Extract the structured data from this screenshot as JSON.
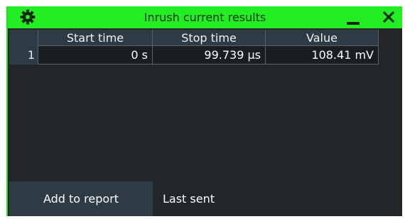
{
  "window": {
    "title": "Inrush current results",
    "accent_color": "#22ee22"
  },
  "icons": {
    "settings": "gear-icon",
    "minimize": "minimize-icon",
    "close": "close-icon"
  },
  "table": {
    "columns": [
      "Start time",
      "Stop time",
      "Value"
    ],
    "rows": [
      {
        "index": "1",
        "start": "0 s",
        "stop": "99.739 µs",
        "value": "108.41 mV"
      }
    ]
  },
  "footer": {
    "add_report_label": "Add to report",
    "last_sent_label": "Last sent"
  }
}
